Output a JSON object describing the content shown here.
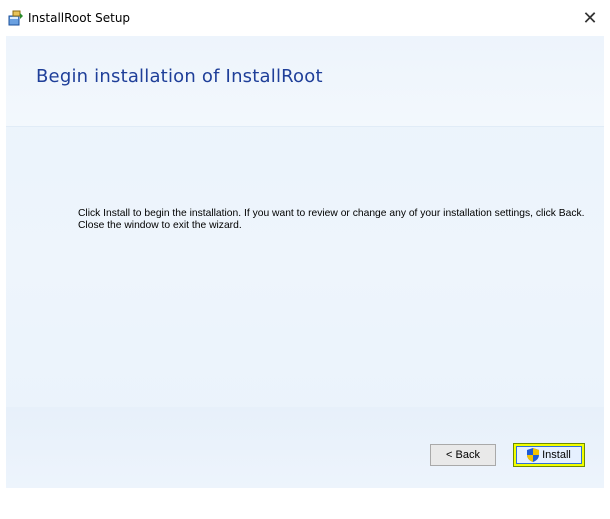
{
  "window": {
    "title": "InstallRoot Setup",
    "close_label": "✕"
  },
  "banner": {
    "title": "Begin installation of InstallRoot"
  },
  "message": {
    "text": "Click Install to begin the installation.  If you want to review or change any of your installation settings, click Back.  Close the window to exit the wizard."
  },
  "buttons": {
    "back_label": "< Back",
    "install_label": "Install"
  },
  "icons": {
    "app": "installer-icon",
    "shield": "uac-shield-icon",
    "close": "close-icon"
  },
  "colors": {
    "banner_title": "#1f3f99",
    "highlight": "#f2ff00"
  }
}
